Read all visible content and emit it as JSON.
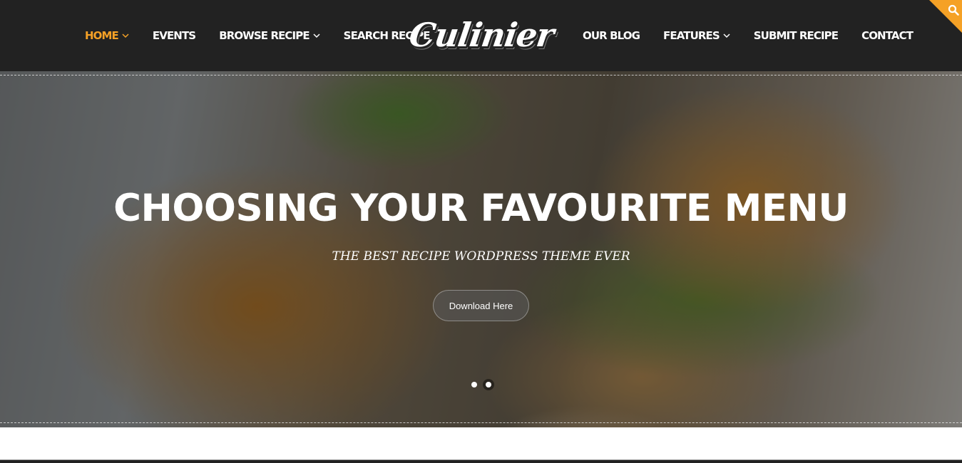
{
  "header": {
    "logo_text": "Culinier",
    "nav_left": [
      {
        "label": "Home",
        "has_dropdown": true,
        "active": true
      },
      {
        "label": "Events",
        "has_dropdown": false,
        "active": false
      },
      {
        "label": "Browse Recipe",
        "has_dropdown": true,
        "active": false
      },
      {
        "label": "Search Recipe",
        "has_dropdown": false,
        "active": false
      }
    ],
    "nav_right": [
      {
        "label": "Our Blog",
        "has_dropdown": false,
        "active": false
      },
      {
        "label": "Features",
        "has_dropdown": true,
        "active": false
      },
      {
        "label": "Submit Recipe",
        "has_dropdown": false,
        "active": false
      },
      {
        "label": "Contact",
        "has_dropdown": false,
        "active": false
      }
    ],
    "search_icon": "search-icon",
    "accent_color": "#f5a126",
    "background_color": "#222222"
  },
  "hero": {
    "title": "Choosing Your Favourite Menu",
    "subtitle": "The Best Recipe WordPress Theme Ever",
    "button_label": "Download Here",
    "slides": [
      {
        "active": false
      },
      {
        "active": true
      }
    ]
  }
}
